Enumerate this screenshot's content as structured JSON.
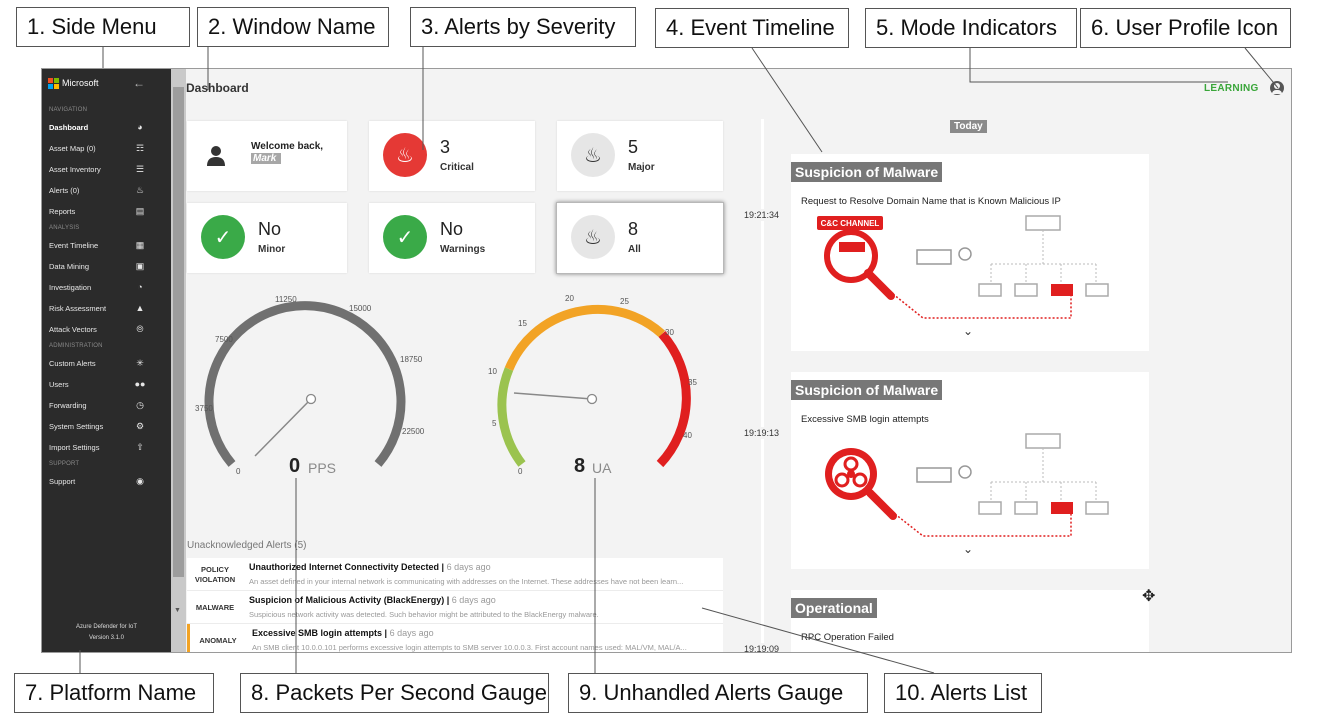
{
  "callouts": [
    "1. Side Menu",
    "2. Window Name",
    "3. Alerts by Severity",
    "4. Event Timeline",
    "5. Mode Indicators",
    "6. User Profile Icon",
    "7. Platform Name",
    "8. Packets Per Second Gauge",
    "9. Unhandled Alerts Gauge",
    "10. Alerts List"
  ],
  "sidebar": {
    "brand": "Microsoft",
    "back_icon": "arrow-left-icon",
    "sections": [
      {
        "title": "NAVIGATION",
        "items": [
          {
            "label": "Dashboard",
            "icon": "speedometer-icon"
          },
          {
            "label": "Asset Map (0)",
            "icon": "sitemap-icon"
          },
          {
            "label": "Asset Inventory",
            "icon": "list-icon"
          },
          {
            "label": "Alerts (0)",
            "icon": "bell-icon"
          },
          {
            "label": "Reports",
            "icon": "document-icon"
          }
        ]
      },
      {
        "title": "ANALYSIS",
        "items": [
          {
            "label": "Event Timeline",
            "icon": "clipboard-icon"
          },
          {
            "label": "Data Mining",
            "icon": "terminal-icon"
          },
          {
            "label": "Investigation",
            "icon": "pie-chart-icon"
          },
          {
            "label": "Risk Assessment",
            "icon": "warning-icon"
          },
          {
            "label": "Attack Vectors",
            "icon": "compass-icon"
          }
        ]
      },
      {
        "title": "ADMINISTRATION",
        "items": [
          {
            "label": "Custom Alerts",
            "icon": "sparkle-icon"
          },
          {
            "label": "Users",
            "icon": "users-icon"
          },
          {
            "label": "Forwarding",
            "icon": "alarm-clock-icon"
          },
          {
            "label": "System Settings",
            "icon": "gear-icon"
          },
          {
            "label": "Import Settings",
            "icon": "upload-icon"
          }
        ]
      },
      {
        "title": "SUPPORT",
        "items": [
          {
            "label": "Support",
            "icon": "help-circle-icon"
          }
        ]
      }
    ],
    "footer_line1": "Azure Defender for IoT",
    "footer_line2": "Version 3.1.0"
  },
  "header": {
    "title": "Dashboard",
    "mode": "LEARNING",
    "user_icon": "user-circle-icon"
  },
  "welcome": {
    "text": "Welcome back,",
    "name": "Mark"
  },
  "severity_cards": [
    {
      "count": "3",
      "label": "Critical",
      "icon": "bell-icon",
      "color": "#e53935"
    },
    {
      "count": "5",
      "label": "Major",
      "icon": "bell-icon",
      "color": "#e6e6e6"
    },
    {
      "count": "No",
      "label": "Minor",
      "icon": "check-icon",
      "color": "#3aaa48"
    },
    {
      "count": "No",
      "label": "Warnings",
      "icon": "check-icon",
      "color": "#3aaa48"
    },
    {
      "count": "8",
      "label": "All",
      "icon": "bell-icon",
      "color": "#e6e6e6"
    }
  ],
  "gauges": {
    "pps": {
      "value": "0",
      "unit": "PPS",
      "max": 22500,
      "ticks": [
        "0",
        "3750",
        "7500",
        "11250",
        "15000",
        "18750",
        "22500"
      ]
    },
    "ua": {
      "value": "8",
      "unit": "UA",
      "max": 40,
      "ticks": [
        "0",
        "5",
        "10",
        "15",
        "20",
        "25",
        "30",
        "35",
        "40"
      ]
    }
  },
  "alerts_list": {
    "title": "Unacknowledged Alerts (5)",
    "rows": [
      {
        "type": "POLICY VIOLATION",
        "name": "Unauthorized Internet Connectivity Detected",
        "age": "6 days ago",
        "desc": "An asset defined in your internal network is communicating with addresses on the Internet. These addresses have not been learn..."
      },
      {
        "type": "MALWARE",
        "name": "Suspicion of Malicious Activity (BlackEnergy)",
        "age": "6 days ago",
        "desc": "Suspicious network activity was detected. Such behavior might be attributed to the BlackEnergy malware."
      },
      {
        "type": "ANOMALY",
        "name": "Excessive SMB login attempts",
        "age": "6 days ago",
        "desc": "An SMB client 10.0.0.101 performs excessive login attempts to SMB server 10.0.0.3. First account names used: MAL/VM, MAL/A..."
      }
    ]
  },
  "timeline": {
    "today": "Today",
    "events": [
      {
        "time": "19:21:34",
        "title": "Suspicion of Malware",
        "desc": "Request to Resolve Domain Name that is Known Malicious IP",
        "badge": "C&C CHANNEL",
        "icon": "server-magnifier-icon"
      },
      {
        "time": "19:19:13",
        "title": "Suspicion of Malware",
        "desc": "Excessive SMB login attempts",
        "badge": "",
        "icon": "biohazard-magnifier-icon"
      },
      {
        "time": "19:19:09",
        "title": "Operational",
        "desc": "RPC Operation Failed",
        "badge": "",
        "icon": ""
      }
    ],
    "expand_icon": "chevron-down-icon"
  },
  "cursor_icon": "move-cursor-icon"
}
